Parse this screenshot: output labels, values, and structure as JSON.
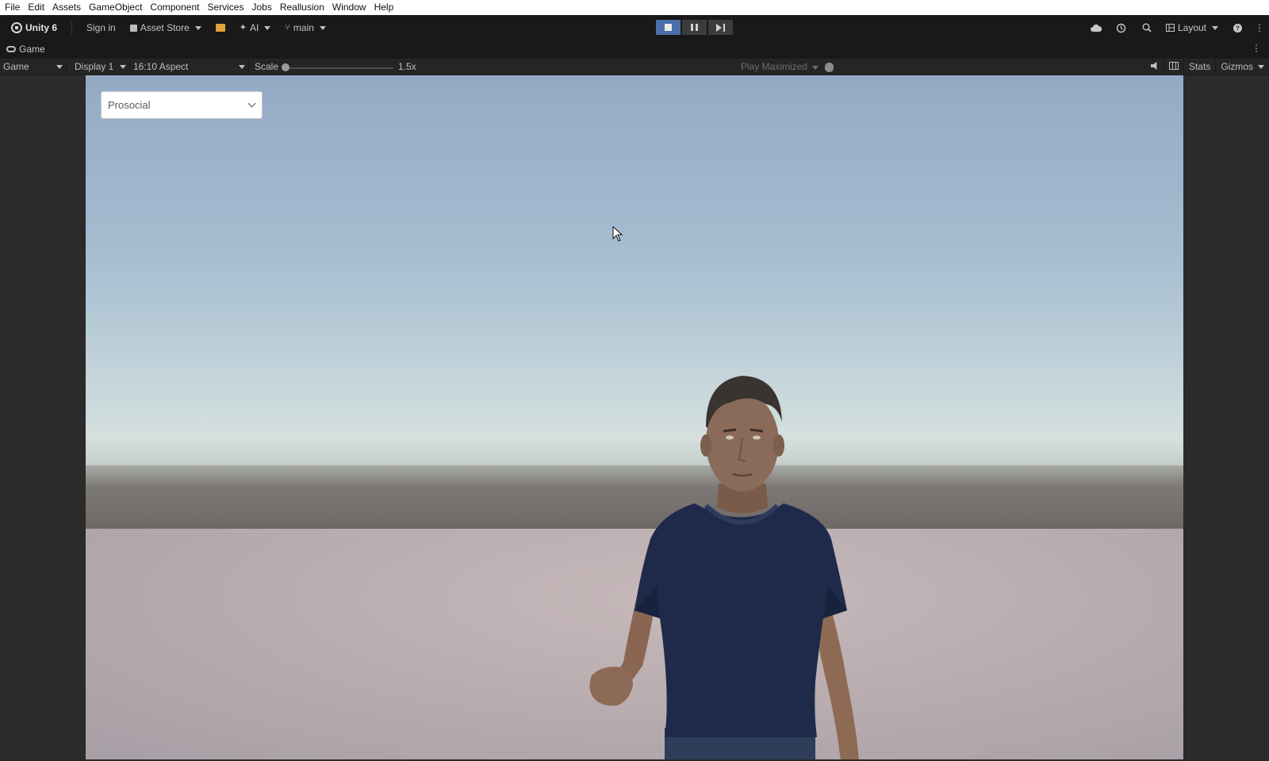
{
  "menu": [
    "File",
    "Edit",
    "Assets",
    "GameObject",
    "Component",
    "Services",
    "Jobs",
    "Reallusion",
    "Window",
    "Help"
  ],
  "toolbar": {
    "product": "Unity 6",
    "sign_in": "Sign in",
    "asset_store": "Asset Store",
    "ai": "AI",
    "branch": "main",
    "layout": "Layout"
  },
  "panel": {
    "tab_label": "Game"
  },
  "game_bar": {
    "mode": "Game",
    "display": "Display 1",
    "aspect": "16:10 Aspect",
    "scale_label": "Scale",
    "scale_value": "1.5x",
    "play_mode": "Play Maximized",
    "stats": "Stats",
    "gizmos": "Gizmos"
  },
  "game_view": {
    "dropdown_value": "Prosocial"
  },
  "colors": {
    "editor_bg": "#191919",
    "play_active": "#4a6fa8",
    "store_icon": "#e1a43b",
    "shirt": "#1f2a4a"
  },
  "icons": [
    "unity-logo-icon",
    "lock-icon",
    "store-icon",
    "sparkle-icon",
    "branch-icon",
    "stop-icon",
    "pause-icon",
    "step-icon",
    "cloud-icon",
    "history-icon",
    "search-icon",
    "layout-icon",
    "help-icon",
    "kebab-icon",
    "gamepad-icon",
    "bug-icon",
    "speaker-icon",
    "grid-icon",
    "chevron-down-icon",
    "cursor-icon"
  ]
}
